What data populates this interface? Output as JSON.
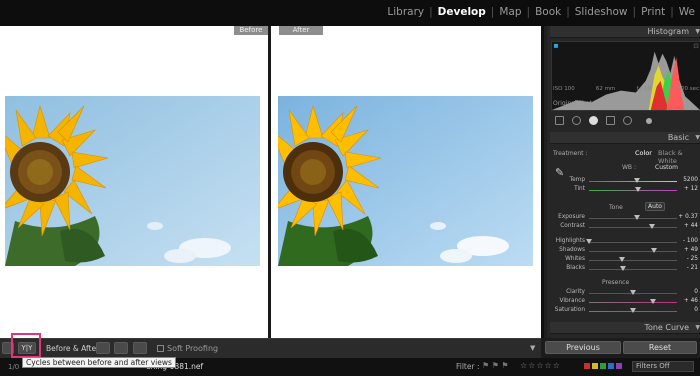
{
  "modules": {
    "items": [
      {
        "label": "Library",
        "active": false
      },
      {
        "label": "Develop",
        "active": true
      },
      {
        "label": "Map",
        "active": false
      },
      {
        "label": "Book",
        "active": false
      },
      {
        "label": "Slideshow",
        "active": false
      },
      {
        "label": "Print",
        "active": false
      },
      {
        "label": "We",
        "active": false
      }
    ]
  },
  "view": {
    "before_label": "Before",
    "after_label": "After",
    "sky_color": "#9fc9e6",
    "petal_color": "#f5b900"
  },
  "toolbar": {
    "view_toggle": "Y|Y",
    "before_after_label": "Before & After :",
    "soft_proofing_label": "Soft Proofing",
    "menu_icon": "▼"
  },
  "tooltip": "Cycles between before and after views",
  "filmstrip": {
    "left_text": "1/0",
    "filename": "ening-0381.nef",
    "filter_label": "Filter :",
    "filters_select": "Filters Off"
  },
  "panel": {
    "histogram_title": "Histogram",
    "info": {
      "iso": "ISO 100",
      "focal": "62 mm",
      "aperture": "f / 10",
      "shutter": "1/100 sec"
    },
    "original_photo": "Original Photo",
    "basic_title": "Basic",
    "treatment_label": "Treatment :",
    "treatment_color": "Color",
    "treatment_bw": "Black & White",
    "wb_label": "WB :",
    "wb_value": "Custom",
    "tone_label": "Tone",
    "auto_label": "Auto",
    "presence_label": "Presence",
    "tone_curve_title": "Tone Curve",
    "previous_label": "Previous",
    "reset_label": "Reset",
    "sliders": {
      "temp": {
        "label": "Temp",
        "value": "5200",
        "pos": 0.55
      },
      "tint": {
        "label": "Tint",
        "value": "+ 12",
        "pos": 0.56
      },
      "exposure": {
        "label": "Exposure",
        "value": "+ 0.37",
        "pos": 0.54
      },
      "contrast": {
        "label": "Contrast",
        "value": "+ 44",
        "pos": 0.72
      },
      "highlights": {
        "label": "Highlights",
        "value": "- 100",
        "pos": 0.0
      },
      "shadows": {
        "label": "Shadows",
        "value": "+ 49",
        "pos": 0.74
      },
      "whites": {
        "label": "Whites",
        "value": "- 25",
        "pos": 0.37
      },
      "blacks": {
        "label": "Blacks",
        "value": "- 21",
        "pos": 0.39
      },
      "clarity": {
        "label": "Clarity",
        "value": "0",
        "pos": 0.5
      },
      "vibrance": {
        "label": "Vibrance",
        "value": "+ 46",
        "pos": 0.73
      },
      "saturation": {
        "label": "Saturation",
        "value": "0",
        "pos": 0.5
      }
    }
  }
}
